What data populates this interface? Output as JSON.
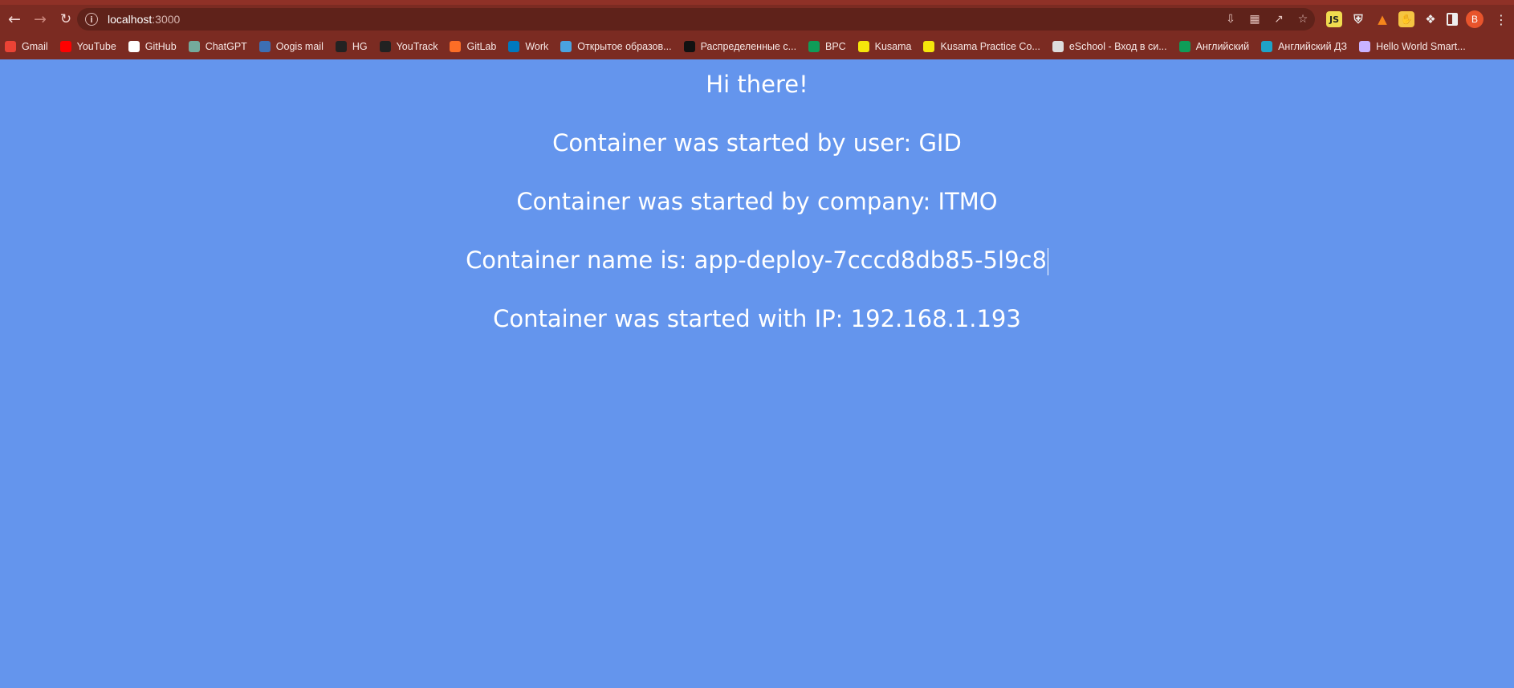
{
  "browser": {
    "url_host": "localhost",
    "url_port": ":3000",
    "avatar_letter": "B",
    "bookmarks": [
      {
        "label": "Gmail",
        "color": "#ea4335"
      },
      {
        "label": "YouTube",
        "color": "#ff0000"
      },
      {
        "label": "GitHub",
        "color": "#ffffff"
      },
      {
        "label": "ChatGPT",
        "color": "#74aa9c"
      },
      {
        "label": "Oogis mail",
        "color": "#3d6fb5"
      },
      {
        "label": "HG",
        "color": "#222222"
      },
      {
        "label": "YouTrack",
        "color": "#222222"
      },
      {
        "label": "GitLab",
        "color": "#fc6d26"
      },
      {
        "label": "Work",
        "color": "#0079bf"
      },
      {
        "label": "Открытое образов...",
        "color": "#4aa3df"
      },
      {
        "label": "Распределенные с...",
        "color": "#111111"
      },
      {
        "label": "ВРС",
        "color": "#0f9d58"
      },
      {
        "label": "Kusama",
        "color": "#f5e60b"
      },
      {
        "label": "Kusama Practice Co...",
        "color": "#f5e60b"
      },
      {
        "label": "eSchool - Вход в си...",
        "color": "#dddddd"
      },
      {
        "label": "Английский",
        "color": "#0f9d58"
      },
      {
        "label": "Английский ДЗ",
        "color": "#1ea3c8"
      },
      {
        "label": "Hello World Smart...",
        "color": "#c9b3ff"
      }
    ]
  },
  "page": {
    "greeting": "Hi there!",
    "user_line": "Container was started by user: GID",
    "company_line": "Container was started by company: ITMO",
    "name_line": "Container name is: app-deploy-7cccd8db85-5l9c8",
    "ip_line": "Container was started with IP: 192.168.1.193"
  },
  "colors": {
    "background": "#6495ed",
    "browser_frame": "#7b2b22",
    "text": "#ffffff"
  }
}
